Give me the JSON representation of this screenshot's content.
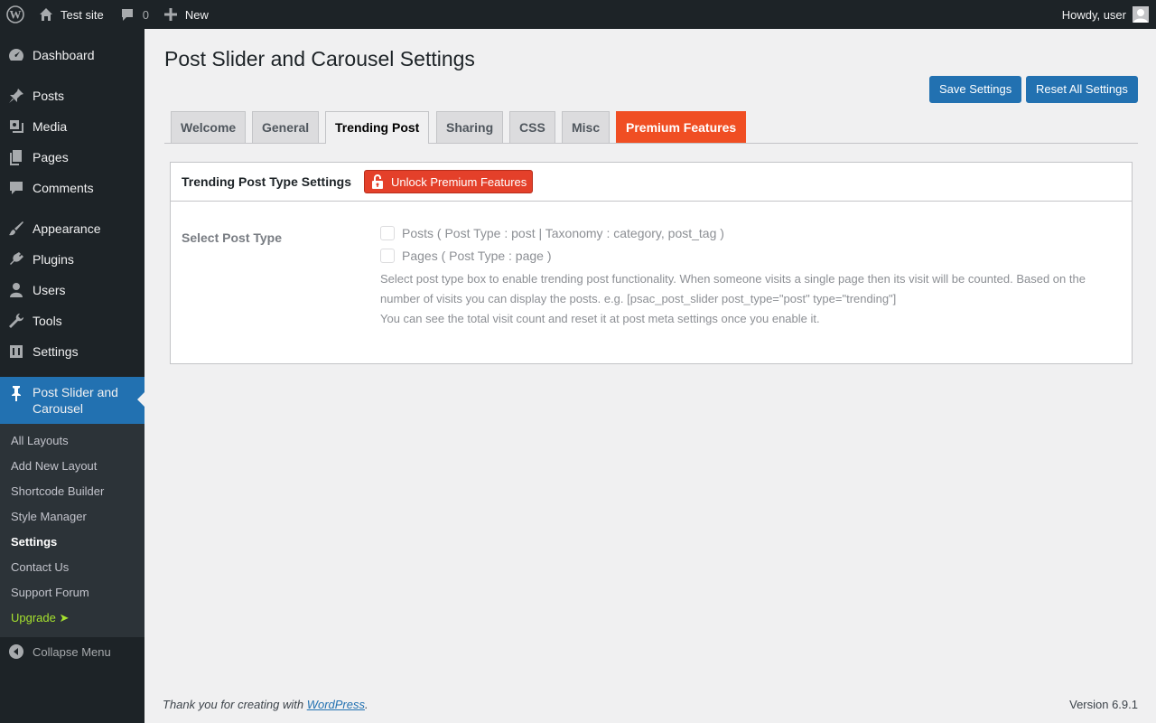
{
  "adminbar": {
    "site_name": "Test site",
    "comments_count": "0",
    "new_label": "New",
    "howdy": "Howdy, user"
  },
  "sidebar": {
    "items": [
      {
        "label": "Dashboard",
        "icon": "dashboard-icon"
      },
      {
        "label": "Posts",
        "icon": "pin-icon"
      },
      {
        "label": "Media",
        "icon": "media-icon"
      },
      {
        "label": "Pages",
        "icon": "pages-icon"
      },
      {
        "label": "Comments",
        "icon": "comment-icon"
      },
      {
        "label": "Appearance",
        "icon": "brush-icon"
      },
      {
        "label": "Plugins",
        "icon": "plug-icon"
      },
      {
        "label": "Users",
        "icon": "user-icon"
      },
      {
        "label": "Tools",
        "icon": "wrench-icon"
      },
      {
        "label": "Settings",
        "icon": "settings-icon"
      },
      {
        "label": "Post Slider and Carousel",
        "icon": "pin-icon"
      }
    ],
    "submenu": [
      "All Layouts",
      "Add New Layout",
      "Shortcode Builder",
      "Style Manager",
      "Settings",
      "Contact Us",
      "Support Forum",
      "Upgrade ➤"
    ],
    "collapse_label": "Collapse Menu"
  },
  "main": {
    "title": "Post Slider and Carousel Settings",
    "save_label": "Save Settings",
    "reset_label": "Reset All Settings",
    "tabs": [
      "Welcome",
      "General",
      "Trending Post",
      "Sharing",
      "CSS",
      "Misc",
      "Premium Features"
    ],
    "active_tab": "Trending Post",
    "panel": {
      "title": "Trending Post Type Settings",
      "unlock_label": "Unlock Premium Features",
      "row_label": "Select Post Type",
      "options": [
        "Posts ( Post Type : post | Taxonomy : category, post_tag )",
        "Pages ( Post Type : page )"
      ],
      "desc_1": "Select post type box to enable trending post functionality. When someone visits a single page then its visit will be counted. Based on the number of visits you can display the posts. e.g. [psac_post_slider post_type=\"post\" type=\"trending\"]",
      "desc_2": "You can see the total visit count and reset it at post meta settings once you enable it."
    }
  },
  "footer": {
    "thanks_prefix": "Thank you for creating with ",
    "wordpress_link": "WordPress",
    "thanks_suffix": ".",
    "version": "Version 6.9.1"
  },
  "colors": {
    "accent": "#2271b1",
    "premium": "#f04e23",
    "upgrade": "#a6e22e"
  }
}
